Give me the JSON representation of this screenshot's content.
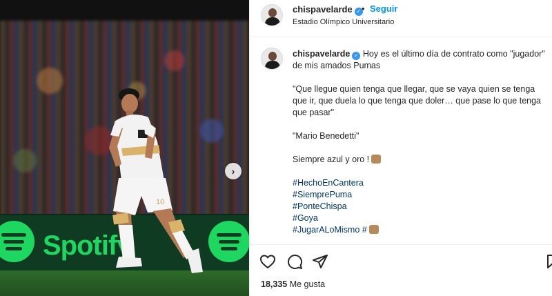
{
  "post": {
    "username": "chispavelarde",
    "follow_label": "Seguir",
    "location": "Estadio Olímpico Universitario",
    "caption_intro": "Hoy es el último día de contrato como \"jugador\" de mis amados Pumas",
    "quote": "\"Que llegue quien tenga que llegar, que se vaya quien se tenga que ir, que duela lo que tenga que doler… que pase lo que tenga que pasar\"",
    "quote_author": "\"Mario Benedetti\"",
    "closing": "Siempre azul y oro !",
    "hashtags": [
      "#HechoEnCantera",
      "#SiemprePuma",
      "#PonteChispa",
      "#Goya",
      "#JugarALoMismo #"
    ],
    "likes_count": "18,335",
    "likes_label": "Me gusta"
  },
  "photo": {
    "ad_text": "Spotify",
    "jersey_number": "10"
  },
  "icons": [
    "verified-icon",
    "heart-icon",
    "comment-icon",
    "share-icon",
    "bookmark-icon",
    "next-arrow-icon"
  ],
  "colors": {
    "link": "#0095f6",
    "hashtag": "#00376b",
    "spotify_green": "#1ed760",
    "verified": "#3897f0"
  }
}
